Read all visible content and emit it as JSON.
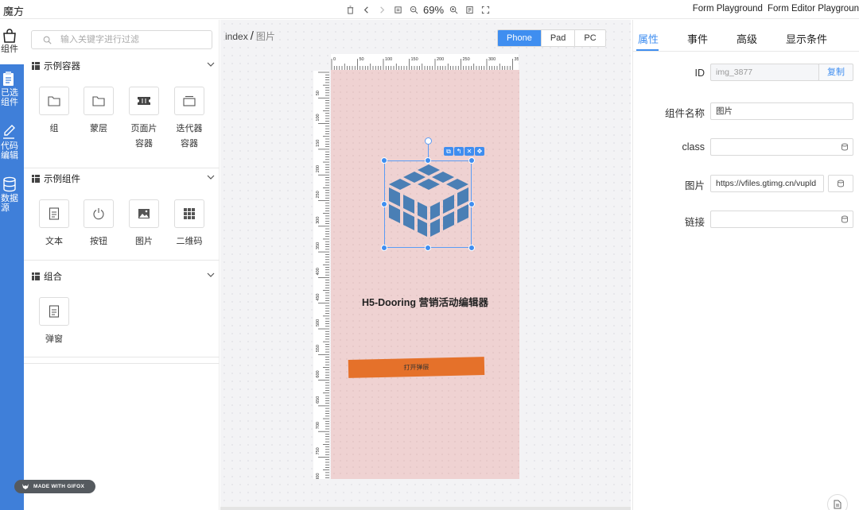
{
  "app": {
    "title": "魔方"
  },
  "toolbar": {
    "zoom": "69%"
  },
  "top_links": [
    "Form Playground",
    "Form Editor Playgroun"
  ],
  "rail": {
    "items": [
      {
        "label_line1": "组件",
        "label_line2": "",
        "icon": "bag-icon"
      },
      {
        "label_line1": "已选",
        "label_line2": "组件",
        "icon": "clipboard-icon"
      },
      {
        "label_line1": "代码",
        "label_line2": "编辑",
        "icon": "pen-icon"
      },
      {
        "label_line1": "数据",
        "label_line2": "源",
        "icon": "database-icon"
      }
    ]
  },
  "search": {
    "placeholder": "输入关键字进行过滤",
    "value": ""
  },
  "sections": [
    {
      "title": "示例容器",
      "items": [
        {
          "label_1": "组",
          "label_2": "",
          "icon": "folder-icon"
        },
        {
          "label_1": "蒙层",
          "label_2": "",
          "icon": "folder-icon"
        },
        {
          "label_1": "页面片",
          "label_2": "容器",
          "icon": "ticket-icon"
        },
        {
          "label_1": "迭代器",
          "label_2": "容器",
          "icon": "window-icon"
        }
      ]
    },
    {
      "title": "示例组件",
      "items": [
        {
          "label_1": "文本",
          "label_2": "",
          "icon": "document-icon"
        },
        {
          "label_1": "按钮",
          "label_2": "",
          "icon": "power-icon"
        },
        {
          "label_1": "图片",
          "label_2": "",
          "icon": "image-icon"
        },
        {
          "label_1": "二维码",
          "label_2": "",
          "icon": "grid-icon"
        }
      ]
    },
    {
      "title": "组合",
      "items": [
        {
          "label_1": "弹窗",
          "label_2": "",
          "icon": "document-icon"
        }
      ]
    }
  ],
  "canvas": {
    "breadcrumb_root": "index",
    "breadcrumb_sep": "/",
    "breadcrumb_page": "图片",
    "device_tabs": [
      "Phone",
      "Pad",
      "PC"
    ],
    "active_device": "Phone",
    "ruler_top_labels": [
      "0",
      "50",
      "100",
      "150",
      "200",
      "250",
      "300",
      "350"
    ],
    "ruler_left_labels": [
      "50",
      "100",
      "150",
      "200",
      "250",
      "300",
      "350",
      "400",
      "450",
      "500",
      "550",
      "600",
      "650",
      "700",
      "750",
      "800"
    ],
    "page_title": "H5-Dooring 营销活动编辑器",
    "page_button": "打开弹层",
    "gif_badge": "MADE WITH GIFOX"
  },
  "props": {
    "tabs": [
      "属性",
      "事件",
      "高级",
      "显示条件"
    ],
    "active_tab": "属性",
    "fields": {
      "id_label": "ID",
      "id_value": "img_3877",
      "copy_label": "复制",
      "name_label": "组件名称",
      "name_value": "图片",
      "class_label": "class",
      "class_value": "",
      "image_label": "图片",
      "image_value": "https://vfiles.gtimg.cn/vupld",
      "link_label": "链接",
      "link_value": ""
    }
  },
  "colors": {
    "accent": "#3f8ef0",
    "rail": "#3f7fd9",
    "phone_bg": "#efd2d2",
    "cube": "#4a7fb5",
    "button": "#e5712a"
  }
}
